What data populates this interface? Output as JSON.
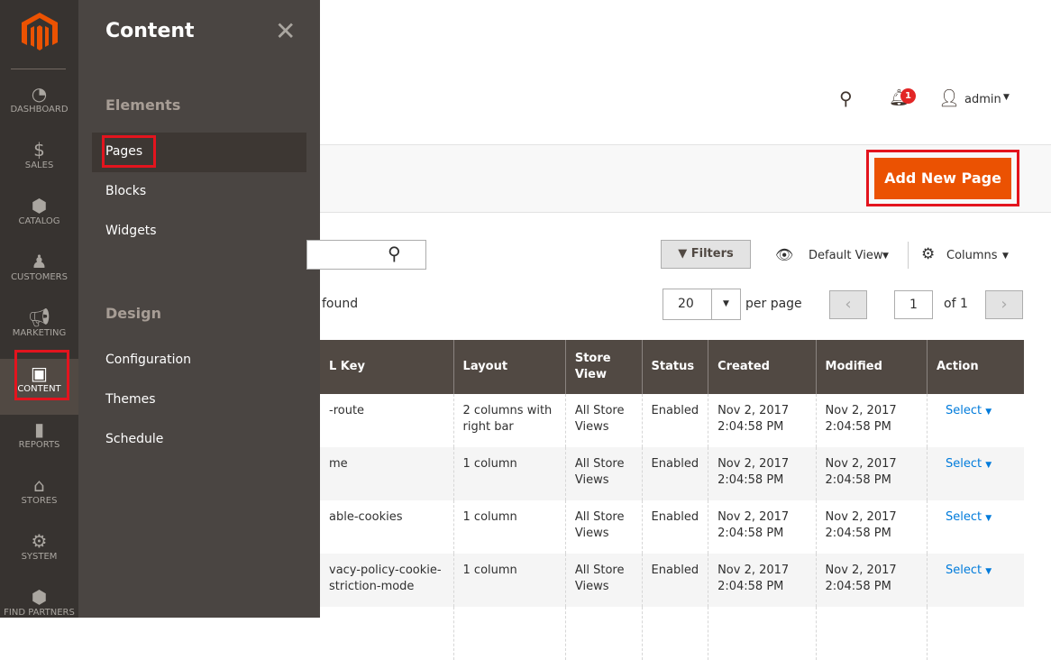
{
  "sidebar": {
    "items": [
      {
        "label": "DASHBOARD",
        "icon": "dashboard-icon"
      },
      {
        "label": "SALES",
        "icon": "dollar-icon"
      },
      {
        "label": "CATALOG",
        "icon": "box-icon"
      },
      {
        "label": "CUSTOMERS",
        "icon": "person-icon"
      },
      {
        "label": "MARKETING",
        "icon": "megaphone-icon"
      },
      {
        "label": "CONTENT",
        "icon": "layout-icon",
        "active": true
      },
      {
        "label": "REPORTS",
        "icon": "bar-chart-icon"
      },
      {
        "label": "STORES",
        "icon": "store-icon"
      },
      {
        "label": "SYSTEM",
        "icon": "gear-icon"
      },
      {
        "label": "FIND PARTNERS",
        "icon": "cubes-icon"
      }
    ]
  },
  "flyout": {
    "title": "Content",
    "sections": [
      {
        "title": "Elements",
        "items": [
          "Pages",
          "Blocks",
          "Widgets"
        ]
      },
      {
        "title": "Design",
        "items": [
          "Configuration",
          "Themes",
          "Schedule"
        ]
      }
    ]
  },
  "header": {
    "notifications": "1",
    "user": "admin"
  },
  "actions": {
    "add_new": "Add New Page"
  },
  "toolbar": {
    "filters": "Filters",
    "view": "Default View",
    "columns": "Columns",
    "found": "found",
    "per_page_value": "20",
    "per_page": "per page",
    "page": "1",
    "of": "of 1"
  },
  "table": {
    "headers": [
      "L Key",
      "Layout",
      "Store View",
      "Status",
      "Created",
      "Modified",
      "Action"
    ],
    "rows": [
      [
        "-route",
        "2 columns with right bar",
        "All Store Views",
        "Enabled",
        "Nov 2, 2017 2:04:58 PM",
        "Nov 2, 2017 2:04:58 PM",
        "Select"
      ],
      [
        "me",
        "1 column",
        "All Store Views",
        "Enabled",
        "Nov 2, 2017 2:04:58 PM",
        "Nov 2, 2017 2:04:58 PM",
        "Select"
      ],
      [
        "able-cookies",
        "1 column",
        "All Store Views",
        "Enabled",
        "Nov 2, 2017 2:04:58 PM",
        "Nov 2, 2017 2:04:58 PM",
        "Select"
      ],
      [
        "vacy-policy-cookie-\nstriction-mode",
        "1 column",
        "All Store Views",
        "Enabled",
        "Nov 2, 2017 2:04:58 PM",
        "Nov 2, 2017 2:04:58 PM",
        "Select"
      ]
    ]
  },
  "colors": {
    "accent": "#eb5202",
    "highlight": "#e3141e",
    "sidebar": "#373330",
    "flyout": "#4a4542",
    "link": "#007bdb"
  }
}
